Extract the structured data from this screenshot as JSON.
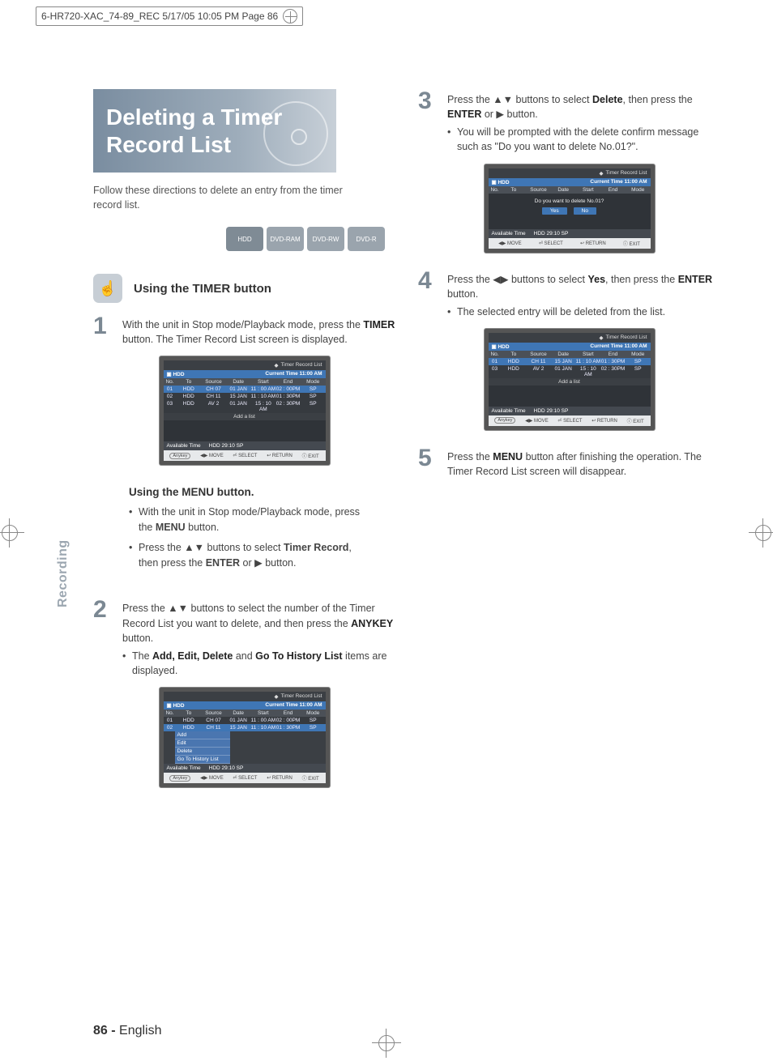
{
  "print_header": "6-HR720-XAC_74-89_REC  5/17/05  10:05 PM  Page 86",
  "side_tab": "Recording",
  "page_footer_num": "86 -",
  "page_footer_lang": "English",
  "title": "Deleting a Timer Record List",
  "intro": "Follow these directions to delete an entry from the timer record list.",
  "media_badges": [
    "HDD",
    "DVD-RAM",
    "DVD-RW",
    "DVD-R"
  ],
  "section1_title": "Using the TIMER button",
  "step1": {
    "pre": "With the unit in Stop mode/Playback mode, press the ",
    "bold1": "TIMER",
    "post": " button. The Timer Record List screen is displayed."
  },
  "menu_section_title": "Using the MENU button.",
  "menu_b1_pre": "With the unit in Stop mode/Playback mode, press the ",
  "menu_b1_bold": "MENU",
  "menu_b1_post": " button.",
  "menu_b2_pre": "Press the ▲▼ buttons to select ",
  "menu_b2_bold": "Timer Record",
  "menu_b2_mid": ", then press the ",
  "menu_b2_bold2": "ENTER",
  "menu_b2_post": " or ▶ button.",
  "step2": {
    "line1": "Press the ▲▼ buttons to select the number of the Timer Record List you want to delete, and then press the ",
    "bold1": "ANYKEY",
    "post": " button.",
    "bullet_pre": "The ",
    "bullet_bold": "Add, Edit, Delete",
    "bullet_mid": " and ",
    "bullet_bold2": "Go To History List",
    "bullet_post": " items are displayed."
  },
  "step3": {
    "line_pre": "Press the ▲▼  buttons to select ",
    "bold1": "Delete",
    "mid": ", then press the ",
    "bold2": "ENTER",
    "post": " or ▶ button.",
    "bullet": "You will be prompted with the delete confirm message such as \"Do you want to delete No.01?\"."
  },
  "step4": {
    "line_pre": "Press the ◀▶ buttons to select ",
    "bold1": "Yes",
    "mid": ", then press the ",
    "bold2": "ENTER",
    "post": " button.",
    "bullet": "The selected entry will be deleted from the list."
  },
  "step5": {
    "line_pre": "Press the ",
    "bold1": "MENU",
    "post": " button after finishing the operation. The Timer Record List screen will disappear."
  },
  "osd_common": {
    "title": "Timer Record List",
    "hdd": "HDD",
    "current_time": "Current Time 11:00 AM",
    "headers": [
      "No.",
      "To",
      "Source",
      "Date",
      "Start",
      "End",
      "Mode"
    ],
    "add": "Add a list",
    "avail": "Available Time",
    "avail_val": "HDD    29:10  SP",
    "footer_anykey": "Anykey",
    "footer_move": "◀▶ MOVE",
    "footer_select": "⏎ SELECT",
    "footer_return": "↩ RETURN",
    "footer_exit": "ⓘ EXIT"
  },
  "osd1_rows": [
    [
      "01",
      "HDD",
      "CH 07",
      "01 JAN",
      "11 : 00 AM",
      "02 : 00PM",
      "SP"
    ],
    [
      "02",
      "HDD",
      "CH 11",
      "15 JAN",
      "11 : 10 AM",
      "01 : 30PM",
      "SP"
    ],
    [
      "03",
      "HDD",
      "AV 2",
      "01 JAN",
      "15 : 10 AM",
      "02 : 30PM",
      "SP"
    ]
  ],
  "osd2_ctx": [
    "Add",
    "Edit",
    "Delete",
    "Go To History List"
  ],
  "osd3_confirm": "Do you want to delete No.01?",
  "osd3_yes": "Yes",
  "osd3_no": "No",
  "osd4_rows": [
    [
      "01",
      "HDD",
      "CH 11",
      "15 JAN",
      "11 : 10 AM",
      "01 : 30PM",
      "SP"
    ],
    [
      "03",
      "HDD",
      "AV 2",
      "01 JAN",
      "15 : 10 AM",
      "02 : 30PM",
      "SP"
    ]
  ]
}
